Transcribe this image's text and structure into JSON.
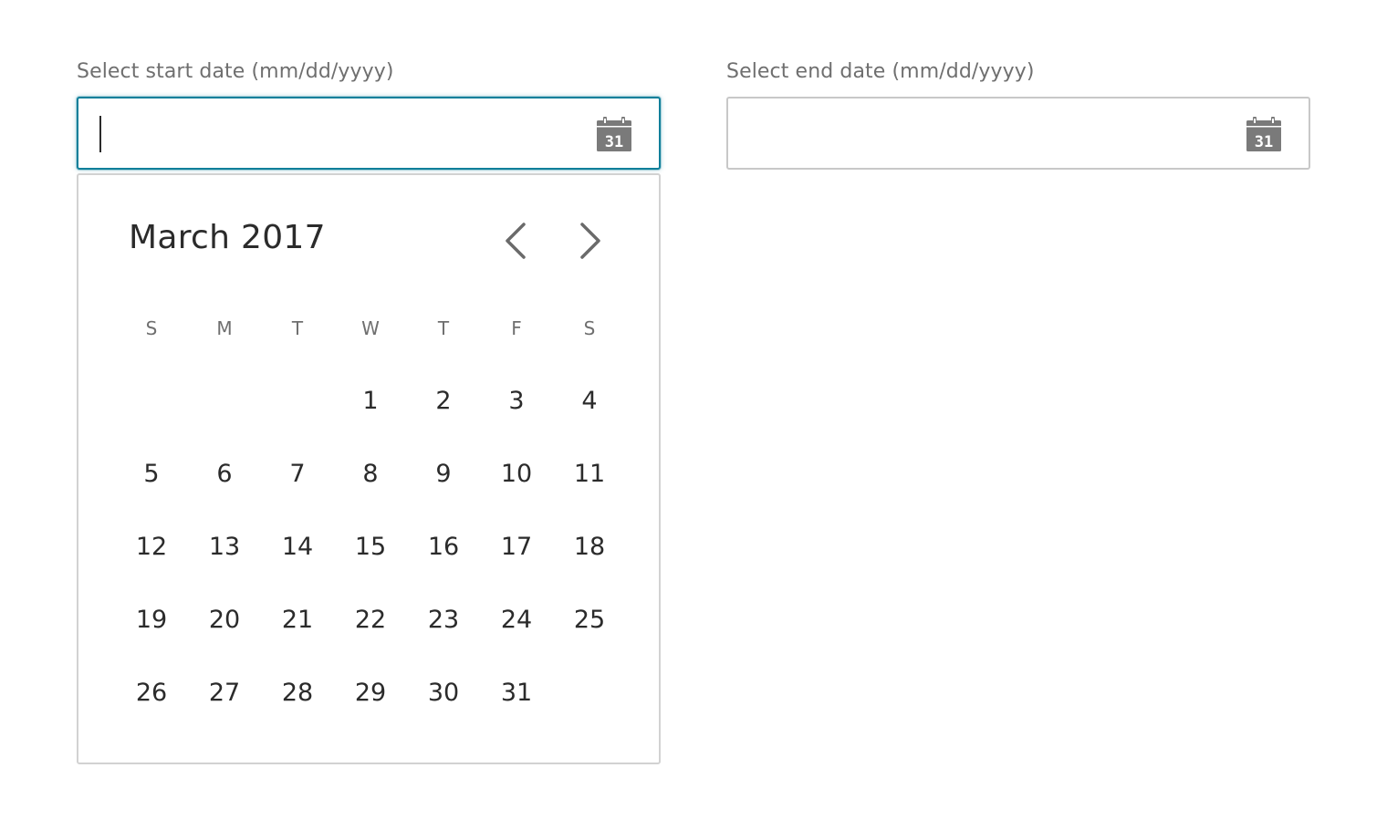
{
  "start_field": {
    "label": "Select start date (mm/dd/yyyy)",
    "value": "",
    "focused": true,
    "icon": "calendar-icon",
    "icon_text": "31"
  },
  "end_field": {
    "label": "Select end date (mm/dd/yyyy)",
    "value": "",
    "focused": false,
    "icon": "calendar-icon",
    "icon_text": "31"
  },
  "calendar": {
    "month_title": "March 2017",
    "prev_icon": "chevron-left-icon",
    "next_icon": "chevron-right-icon",
    "weekdays": [
      "S",
      "M",
      "T",
      "W",
      "T",
      "F",
      "S"
    ],
    "weeks": [
      [
        "",
        "",
        "",
        "1",
        "2",
        "3",
        "4"
      ],
      [
        "5",
        "6",
        "7",
        "8",
        "9",
        "10",
        "11"
      ],
      [
        "12",
        "13",
        "14",
        "15",
        "16",
        "17",
        "18"
      ],
      [
        "19",
        "20",
        "21",
        "22",
        "23",
        "24",
        "25"
      ],
      [
        "26",
        "27",
        "28",
        "29",
        "30",
        "31",
        ""
      ]
    ]
  },
  "colors": {
    "focus_border": "#0f7f9a",
    "border": "#c8c8c8",
    "icon": "#7a7a7a",
    "label": "#6f6f6f",
    "text": "#2b2b2b"
  }
}
